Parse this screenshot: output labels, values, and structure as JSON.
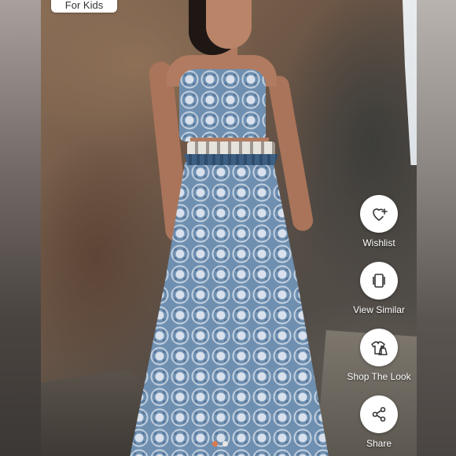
{
  "chip": {
    "label": "For Kids"
  },
  "actions": [
    {
      "label": "Wishlist",
      "icon": "heart-plus-icon"
    },
    {
      "label": "View Similar",
      "icon": "stacked-cards-icon"
    },
    {
      "label": "Shop The Look",
      "icon": "outfit-icon"
    },
    {
      "label": "Share",
      "icon": "share-icon"
    }
  ],
  "carousel": {
    "total": 2,
    "active": 1
  },
  "colors": {
    "active_dot": "#e07a4a",
    "button_bg": "#ffffff",
    "icon_stroke": "#333333"
  }
}
